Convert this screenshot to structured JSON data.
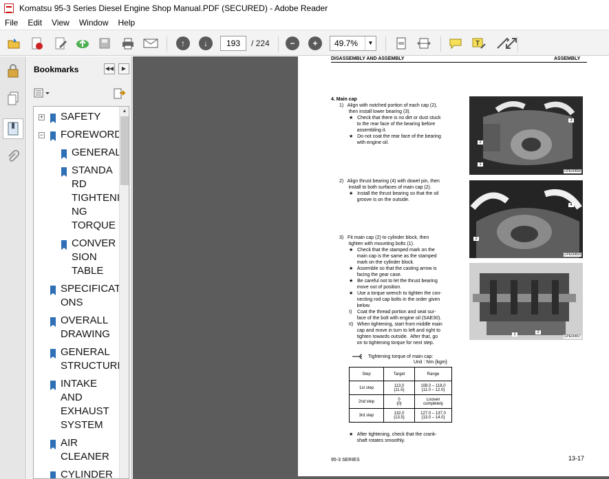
{
  "window": {
    "title": "Komatsu 95-3 Series Diesel Engine Shop Manual.PDF (SECURED) - Adobe Reader"
  },
  "menu": [
    "File",
    "Edit",
    "View",
    "Window",
    "Help"
  ],
  "toolbar": {
    "page_current": "193",
    "page_total": "/ 224",
    "zoom": "49.7%"
  },
  "bookmarks": {
    "title": "Bookmarks",
    "items": [
      {
        "label": "SAFETY",
        "level": 0,
        "expander": "+"
      },
      {
        "label": "FOREWORD",
        "level": 0,
        "expander": "-"
      },
      {
        "label": "GENERAL",
        "level": 1
      },
      {
        "label": "STANDA\nRD\nTIGHTENI\nNG\nTORQUE",
        "level": 1
      },
      {
        "label": "CONVER\nSION\nTABLE",
        "level": 1
      },
      {
        "label": "SPECIFICATI\nONS",
        "level": 0
      },
      {
        "label": "OVERALL\nDRAWING",
        "level": 0
      },
      {
        "label": "GENERAL\nSTRUCTURE",
        "level": 0
      },
      {
        "label": "INTAKE\nAND\nEXHAUST\nSYSTEM",
        "level": 0
      },
      {
        "label": "AIR\nCLEANER",
        "level": 0
      },
      {
        "label": "CYLINDER",
        "level": 0
      }
    ]
  },
  "document": {
    "header_left": "DISASSEMBLY AND ASSEMBLY",
    "header_right": "ASSEMBLY",
    "section_title": "4.   Main cap",
    "step1": "1)   Align with notched portion of each cap (2),\n       then install lower bearing (3).",
    "step1_notes": "★   Check that there is no dirt or dust stuck\n      to the rear face of the bearing before\n      assembling it.\n★   Do not coat the rear face of the bearing\n      with engine oil.",
    "step2": "2)   Align thrust bearing (4) with dowel pin, then\n       install to both surfaces of main cap (2).",
    "step2_notes": "★   Install the thrust bearing so that the oil\n      groove is on the outside.",
    "step3": "3)   Fit main cap (2) to cylinder block, then\n       tighten with mounting bolts (1).",
    "step3_notes": "★   Check that the stamped mark on the\n      main cap is the same as the stamped\n      mark on the cylinder block.\n★   Assemble so that the casting arrow is\n      facing the gear case.\n★   Be careful not to let the thrust bearing\n      move out of position.\n★   Use a torque wrench to tighten the con-\n      necting rod cap bolts in the order given\n      below.\nI)    Coat the thread portion and seat sur-\n      face of the bolt with engine oil (SAE30).\nII)   When tightening, start from middle main\n      cap and move in turn to left and right to\n      tighten towards outside.  After that, go\n      on to tightening torque for next step.",
    "torque_title": "Tightening torque of main cap:",
    "torque_unit": "Unit : Nm {kgm}",
    "table": {
      "headers": [
        "Step",
        "Target",
        "Range"
      ],
      "rows": [
        [
          "1st step",
          "113.0\n{11.5}",
          "108.0 – 118.0\n{11.0 – 12.0}"
        ],
        [
          "2nd step",
          "0\n{0}",
          "Loosen\ncompletely"
        ],
        [
          "3rd step",
          "132.0\n{13.5}",
          "127.0 – 137.0\n{13.0 – 14.0}"
        ]
      ]
    },
    "final_note": "★   After tightening, check that the crank-\n      shaft rotates smoothly.",
    "footer_left": "95-3 SERIES",
    "footer_right": "13-17",
    "photos": [
      {
        "label": "CPE00658",
        "callouts": [
          "3",
          "2",
          "1"
        ]
      },
      {
        "label": "CPE00659",
        "callouts": [
          "4",
          "2"
        ]
      },
      {
        "label": "CPE00657",
        "callouts": [
          "1",
          "2"
        ]
      }
    ]
  }
}
